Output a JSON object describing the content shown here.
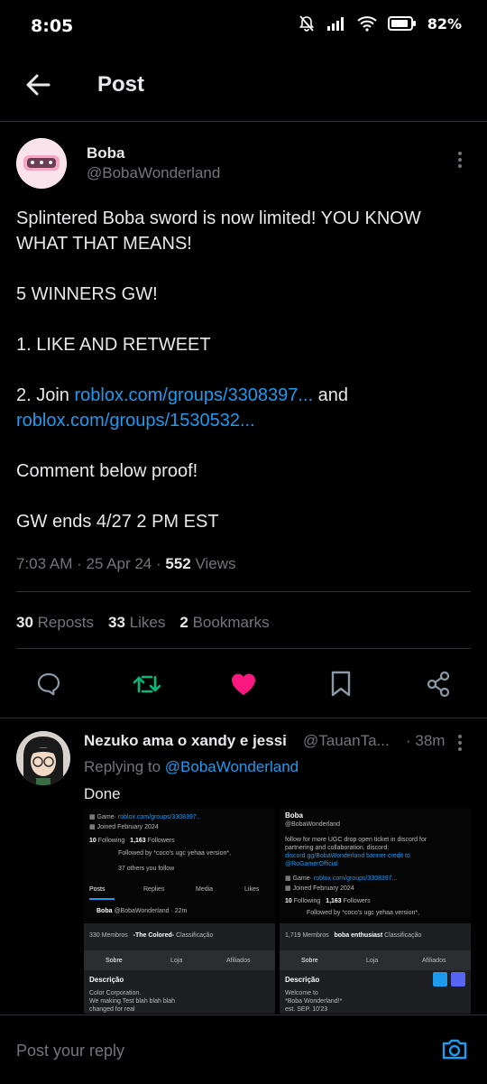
{
  "status_bar": {
    "time": "8:05",
    "battery": "82%"
  },
  "header": {
    "title": "Post"
  },
  "post": {
    "author_name": "Boba",
    "author_handle": "@BobaWonderland",
    "line1": "Splintered Boba sword is now limited! YOU KNOW WHAT THAT MEANS!",
    "line2": "5 WINNERS GW!",
    "line3": "1. LIKE AND RETWEET",
    "line4_prefix": "2. Join ",
    "link1": "roblox.com/groups/3308397...",
    "line4_and": " and",
    "link2": "roblox.com/groups/1530532...",
    "line5": "Comment below proof!",
    "line6": "GW ends 4/27 2 PM EST",
    "time": "7:03 AM",
    "date": "25 Apr 24",
    "views_count": "552",
    "views_label": " Views",
    "reposts_count": "30",
    "reposts_label": "Reposts",
    "likes_count": "33",
    "likes_label": "Likes",
    "bookmarks_count": "2",
    "bookmarks_label": "Bookmarks",
    "colors": {
      "repost": "#00ba7c",
      "like": "#f91880",
      "link": "#1d9bf0"
    }
  },
  "reply": {
    "name": "Nezuko ama o xandy e jessi",
    "handle": "@TauanTa...",
    "time": "· 38m",
    "replying_prefix": "Replying to ",
    "replying_to": "@BobaWonderland",
    "text": "Done"
  },
  "screenshot_left": {
    "game_link": "roblox.com/groups/3308397..",
    "joined": "Joined February 2024",
    "following": "10",
    "following_label": "Following",
    "followers": "1,163",
    "followers_label": "Followers",
    "followed_by": "Followed by *coco's ugc yehaa version*,",
    "followed_more": "37 others you follow",
    "tabs": [
      "Posts",
      "Replies",
      "Media",
      "Likes"
    ],
    "post_author": "Boba",
    "post_handle": "@BobaWonderland · 22m",
    "members": "330 Membros",
    "group_name": "-The Colored-",
    "classif": "Classificação",
    "subtabs": [
      "Sobre",
      "Loja",
      "Afiliados"
    ],
    "desc_title": "Descrição",
    "desc1": "Color Corporation.",
    "desc2": "We making Test blah blah blah",
    "desc3": "changed for real"
  },
  "screenshot_right": {
    "name": "Boba",
    "handle": "@BobaWonderland",
    "bio1": "follow for more UGC drop open ticket in discord for",
    "bio2": "partnering and collaboration. discord:",
    "bio3": "discord.gg/BobaWonderland banner credit to",
    "bio4": "@RoGamerOfficial",
    "game_link": "roblox.com/groups/3308397...",
    "joined": "Joined February 2024",
    "following": "10",
    "following_label": "Following",
    "followers": "1,163",
    "followers_label": "Followers",
    "followed_by": "Followed by *coco's ugc yehaa version*,",
    "members": "1,719 Membros",
    "group_name": "boba enthusiast",
    "classif": "Classificação",
    "subtabs": [
      "Sobre",
      "Loja",
      "Afiliados"
    ],
    "desc_title": "Descrição",
    "desc1": "Welcome to",
    "desc2": "*Boba Wonderland!*",
    "desc3": "est. SEP. 10'23"
  },
  "reply_bar": {
    "placeholder": "Post your reply"
  }
}
